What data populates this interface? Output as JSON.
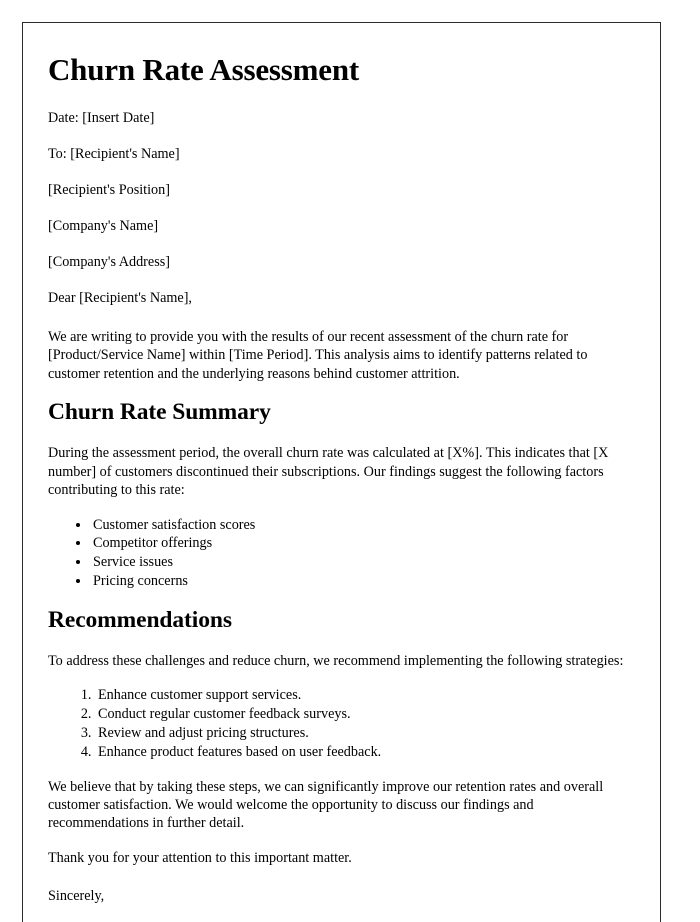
{
  "document": {
    "title": "Churn Rate Assessment",
    "meta": {
      "date_line": "Date: [Insert Date]",
      "recipient_name_line": "To: [Recipient's Name]",
      "recipient_position_line": "[Recipient's Position]",
      "company_name_line": "[Company's Name]",
      "company_address_line": "[Company's Address]"
    },
    "salutation": "Dear [Recipient's Name],",
    "intro_paragraph": "We are writing to provide you with the results of our recent assessment of the churn rate for [Product/Service Name] within [Time Period]. This analysis aims to identify patterns related to customer retention and the underlying reasons behind customer attrition.",
    "summary_section": {
      "heading": "Churn Rate Summary",
      "paragraph": "During the assessment period, the overall churn rate was calculated at [X%]. This indicates that [X number] of customers discontinued their subscriptions. Our findings suggest the following factors contributing to this rate:",
      "factors": [
        "Customer satisfaction scores",
        "Competitor offerings",
        "Service issues",
        "Pricing concerns"
      ]
    },
    "recommendations_section": {
      "heading": "Recommendations",
      "intro": "To address these challenges and reduce churn, we recommend implementing the following strategies:",
      "strategies": [
        "Enhance customer support services.",
        "Conduct regular customer feedback surveys.",
        "Review and adjust pricing structures.",
        "Enhance product features based on user feedback."
      ]
    },
    "closing_paragraph": "We believe that by taking these steps, we can significantly improve our retention rates and overall customer satisfaction. We would welcome the opportunity to discuss our findings and recommendations in further detail.",
    "thanks_paragraph": "Thank you for your attention to this important matter.",
    "signoff": "Sincerely,"
  }
}
